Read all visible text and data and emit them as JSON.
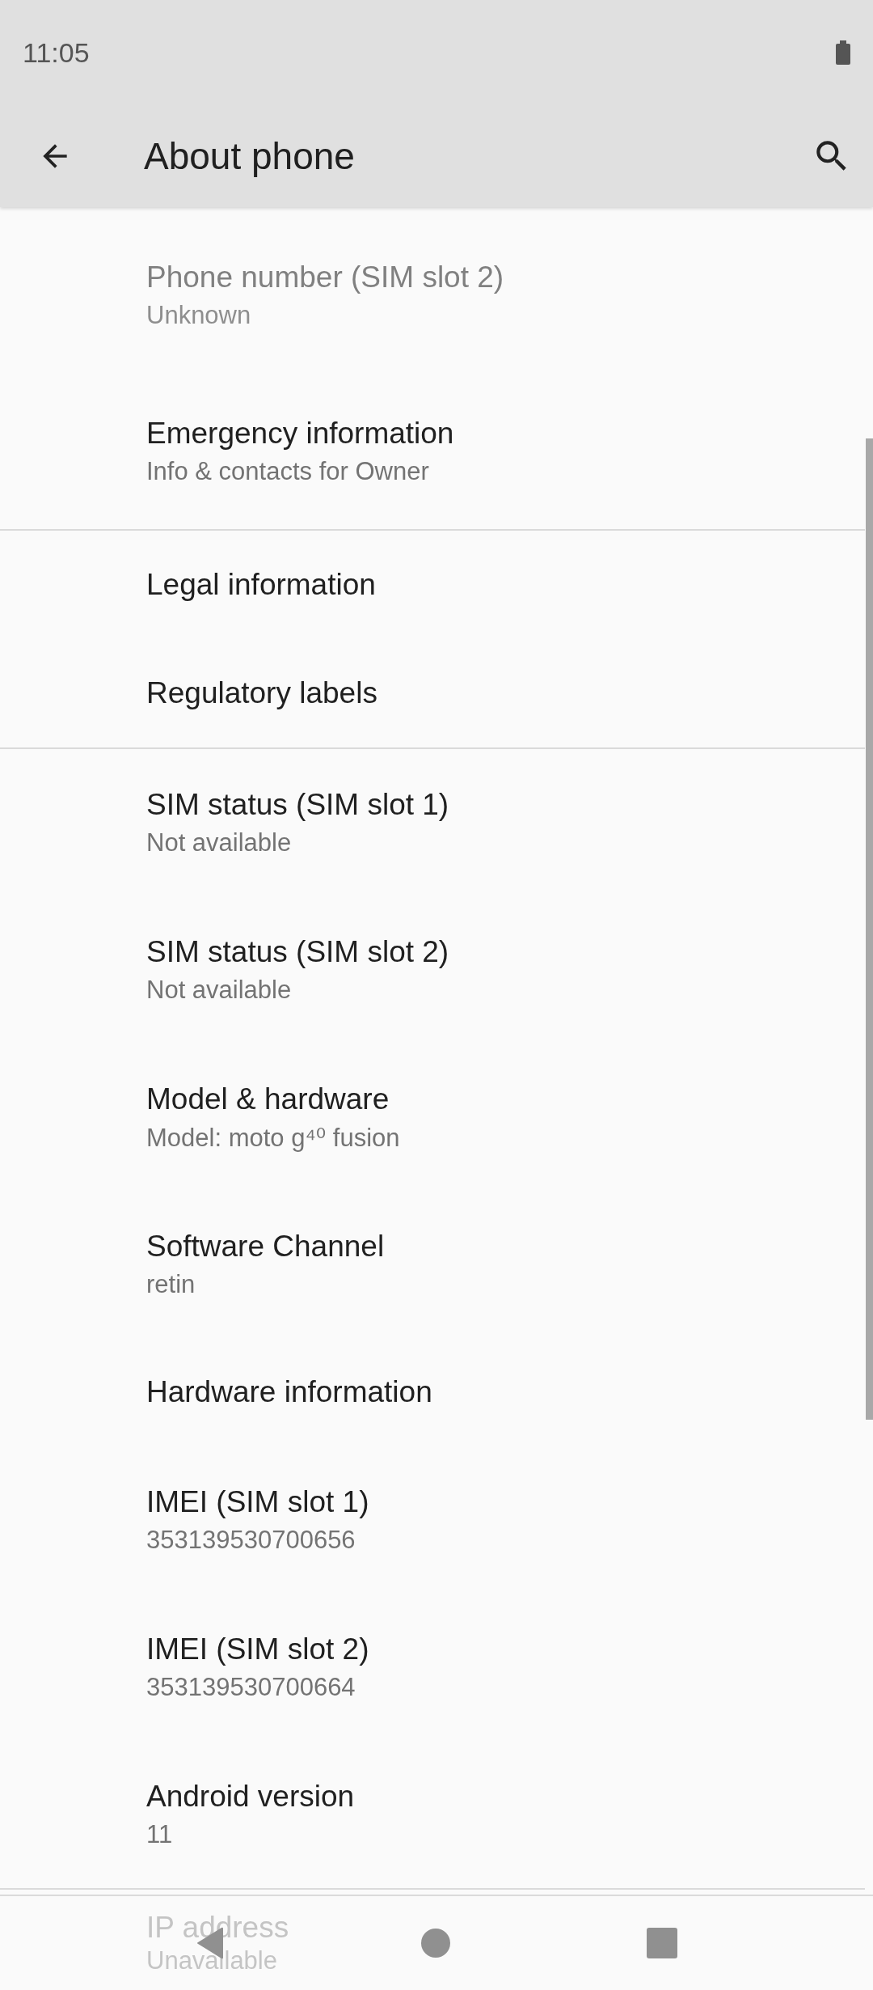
{
  "status_bar": {
    "time": "11:05"
  },
  "app_bar": {
    "title": "About phone"
  },
  "groups": [
    {
      "items": [
        {
          "title": "Phone number (SIM slot 2)",
          "summary": "Unknown",
          "disabled": true
        },
        {
          "title": "Emergency information",
          "summary": "Info & contacts for Owner",
          "disabled": false
        }
      ]
    },
    {
      "items": [
        {
          "title": "Legal information",
          "disabled": false
        },
        {
          "title": "Regulatory labels",
          "disabled": false
        }
      ]
    },
    {
      "items": [
        {
          "title": "SIM status (SIM slot 1)",
          "summary": "Not available",
          "disabled": false
        },
        {
          "title": "SIM status (SIM slot 2)",
          "summary": "Not available",
          "disabled": false
        },
        {
          "title": "Model & hardware",
          "summary": "Model: moto g⁴⁰ fusion",
          "disabled": false
        },
        {
          "title": "Software Channel",
          "summary": "retin",
          "disabled": false
        },
        {
          "title": "Hardware information",
          "disabled": false
        },
        {
          "title": "IMEI (SIM slot 1)",
          "summary": "353139530700656",
          "disabled": false
        },
        {
          "title": "IMEI (SIM slot 2)",
          "summary": "353139530700664",
          "disabled": false
        },
        {
          "title": "Android version",
          "summary": "11",
          "disabled": false
        }
      ]
    },
    {
      "items": [
        {
          "title": "IP address",
          "summary": "Unavailable"
        }
      ]
    }
  ]
}
